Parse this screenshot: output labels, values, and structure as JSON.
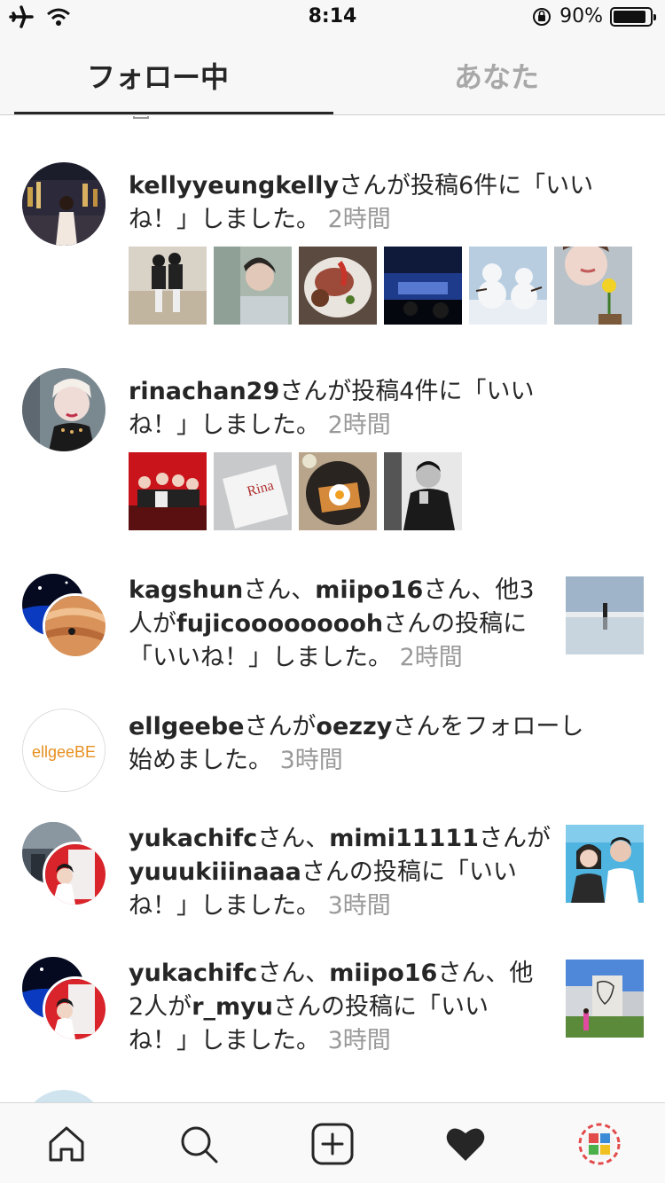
{
  "status_bar": {
    "time": "8:14",
    "battery_percent": "90%",
    "battery_level": 0.9
  },
  "tabs": {
    "following": "フォロー中",
    "you": "あなた"
  },
  "feed": {
    "items": [
      {
        "user": "kellyyeungkelly",
        "text_l1": "さんが投稿6件に「いい",
        "text_l2": "ね！」しました。",
        "time": "2時間"
      },
      {
        "user": "rinachan29",
        "text_l1": "さんが投稿4件に「いい",
        "text_l2": "ね！」しました。",
        "time": "2時間"
      },
      {
        "user1": "kagshun",
        "sep1": "さん、",
        "user2": "miipo16",
        "text_a": "さん、他3",
        "l2_prefix": "人が",
        "target": "fujicooooooooh",
        "l2_suffix": "さんの投稿に",
        "l3": "「いいね！」しました。",
        "time": "2時間"
      },
      {
        "user": "ellgeebe",
        "mid": "さんが",
        "target": "oezzy",
        "l1_suffix": "さんをフォローし",
        "l2": "始めました。",
        "time": "3時間",
        "avatar_text": "ellgeeBE"
      },
      {
        "user1": "yukachifc",
        "sep1": "さん、",
        "user2": "mimi11111",
        "l1_suffix": "さんが",
        "target": "yuuukiiinaaa",
        "l2_suffix": "さんの投稿に「いい",
        "l3": "ね！」しました。",
        "time": "3時間"
      },
      {
        "user1": "yukachifc",
        "sep1": "さん、",
        "user2": "miipo16",
        "l1_suffix": "さん、他",
        "l2_prefix": "2人が",
        "target": "r_myu",
        "l2_suffix": "さんの投稿に「いい",
        "l3": "ね！」しました。",
        "time": "3時間"
      }
    ]
  },
  "tab_bar": {
    "items": [
      "home-icon",
      "search-icon",
      "add-post-icon",
      "heart-icon",
      "profile-avatar"
    ]
  },
  "colors": {
    "text": "#262626",
    "muted": "#999999",
    "tab_inactive": "#a8a8a8",
    "ellgee_orange": "#e8901f"
  }
}
